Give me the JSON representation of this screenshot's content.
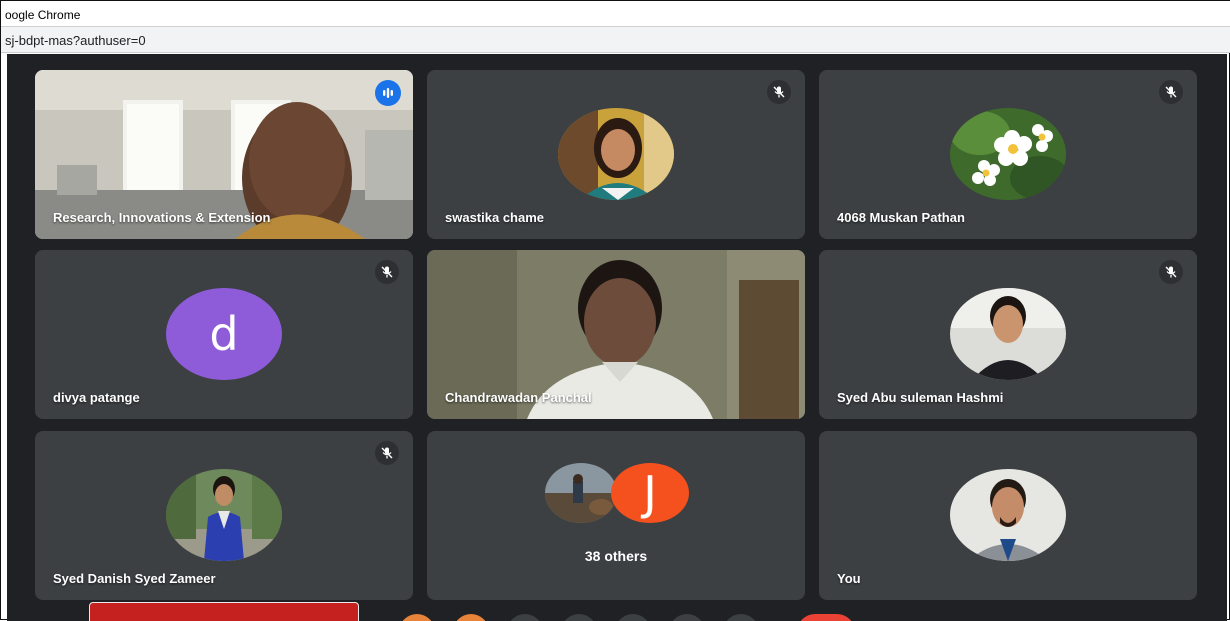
{
  "window": {
    "title": "oogle Chrome",
    "url": "sj-bdpt-mas?authuser=0"
  },
  "tiles": [
    {
      "name": "Research, Innovations & Extension",
      "state": "speaking"
    },
    {
      "name": "swastika chame",
      "state": "muted"
    },
    {
      "name": "4068 Muskan Pathan",
      "state": "muted"
    },
    {
      "name": "divya patange",
      "state": "muted",
      "avatar_letter": "d",
      "avatar_color": "#8e5cd9"
    },
    {
      "name": "Chandrawadan Panchal",
      "state": "video"
    },
    {
      "name": "Syed Abu suleman Hashmi",
      "state": "muted"
    },
    {
      "name": "Syed Danish Syed Zameer",
      "state": "muted"
    },
    {
      "name": "38 others",
      "avatar_letter": "J",
      "avatar_color": "#f4511e"
    },
    {
      "name": "You"
    }
  ],
  "colors": {
    "meet_background": "#202124",
    "tile_background": "#3c4043",
    "active_border": "#8ab4f8",
    "speaking_indicator": "#1a73e8",
    "end_call": "#c5221f"
  },
  "icons": {
    "muted": "mic-off-icon",
    "speaking": "audio-level-icon"
  }
}
